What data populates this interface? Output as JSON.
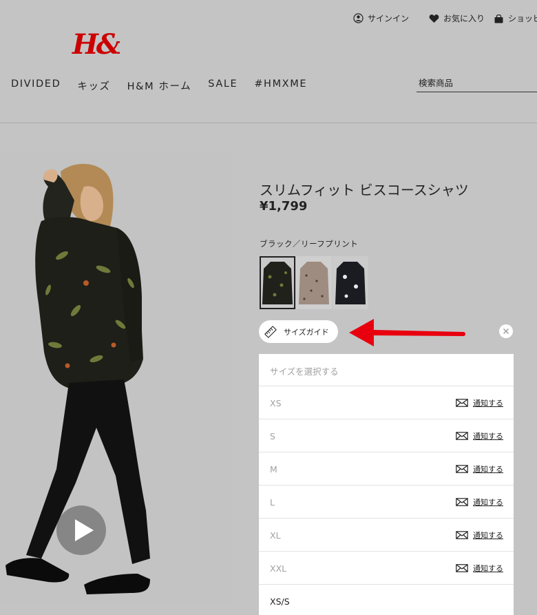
{
  "header": {
    "sign_in": "サインイン",
    "favorites": "お気に入り",
    "shopping_bag": "ショッピ",
    "logo_text": "H&M",
    "nav": [
      "DIVIDED",
      "キッズ",
      "H&M ホーム",
      "SALE",
      "#HMXME"
    ],
    "search_placeholder": "検索商品"
  },
  "product": {
    "title": "スリムフィット ビスコースシャツ",
    "price": "¥1,799",
    "color_name": "ブラック／リーフプリント",
    "swatches": [
      "black-leaf-print",
      "beige-print",
      "black-floral-print"
    ],
    "size_guide_label": "サイズガイド"
  },
  "size_selector": {
    "placeholder": "サイズを選択する",
    "notify_label": "通知する",
    "sizes": [
      {
        "label": "XS",
        "available": false
      },
      {
        "label": "S",
        "available": false
      },
      {
        "label": "M",
        "available": false
      },
      {
        "label": "L",
        "available": false
      },
      {
        "label": "XL",
        "available": false
      },
      {
        "label": "XXL",
        "available": false
      },
      {
        "label": "XS/S",
        "available": true
      }
    ]
  },
  "colors": {
    "brand_red": "#cc0000",
    "annotation_arrow": "#e8000e",
    "background": "#c4c4c4"
  }
}
